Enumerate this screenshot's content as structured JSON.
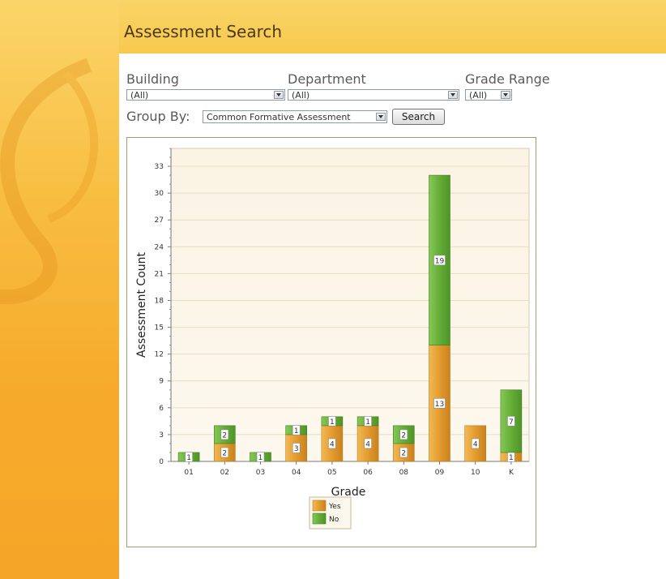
{
  "header": {
    "title": "Assessment Search"
  },
  "filters": {
    "building": {
      "label": "Building",
      "value": "(All)"
    },
    "department": {
      "label": "Department",
      "value": "(All)"
    },
    "grade_range": {
      "label": "Grade Range",
      "value": "(All)"
    },
    "group_by": {
      "label": "Group By:",
      "value": "Common Formative Assessment"
    },
    "search_button": "Search"
  },
  "chart_data": {
    "type": "bar",
    "stacked": true,
    "categories": [
      "01",
      "02",
      "03",
      "04",
      "05",
      "06",
      "08",
      "09",
      "10",
      "K"
    ],
    "series": [
      {
        "name": "Yes",
        "color": "#e8a53c",
        "values": [
          0,
          2,
          0,
          3,
          4,
          4,
          2,
          13,
          4,
          1
        ]
      },
      {
        "name": "No",
        "color": "#6cb33e",
        "values": [
          1,
          2,
          1,
          1,
          1,
          1,
          2,
          19,
          0,
          7
        ]
      }
    ],
    "xlabel": "Grade",
    "ylabel": "Assessment Count",
    "ylim": [
      0,
      35
    ],
    "yticks": [
      0,
      3,
      6,
      9,
      12,
      15,
      18,
      21,
      24,
      27,
      30,
      33
    ],
    "grid": true,
    "legend": "bottom-center"
  }
}
